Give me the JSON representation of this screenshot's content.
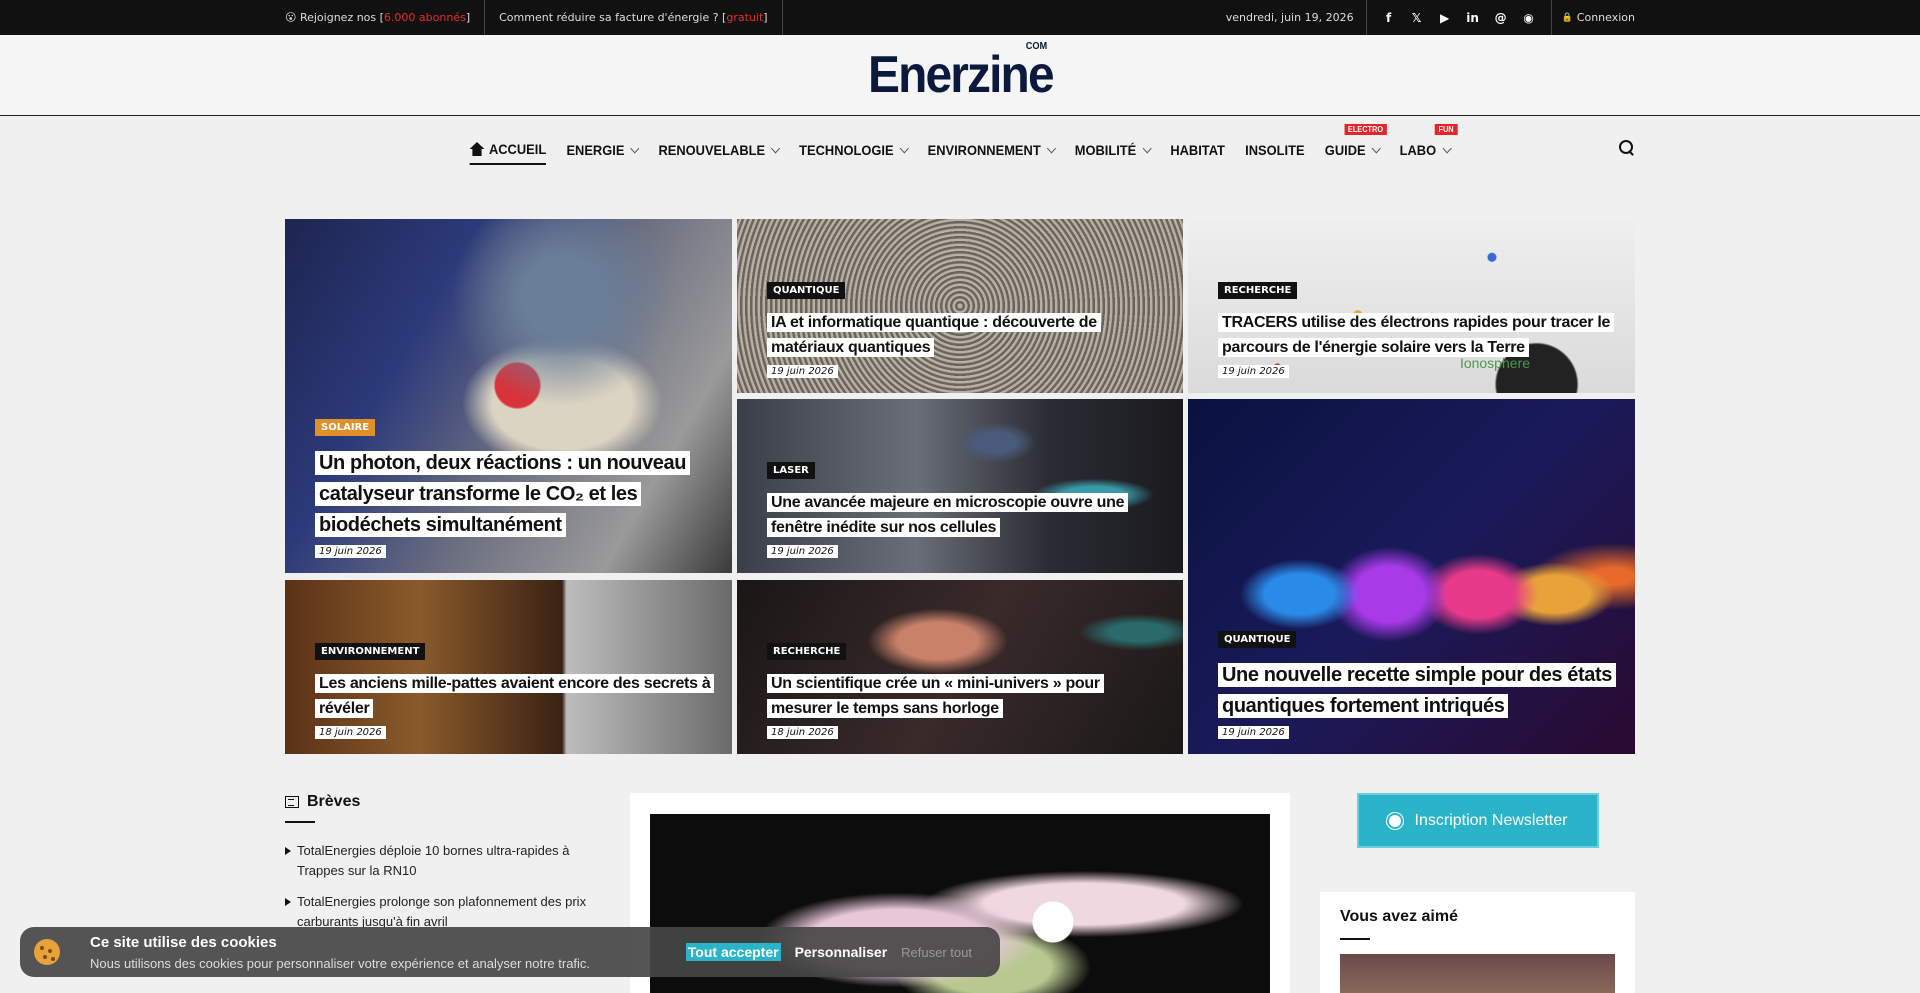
{
  "topbar": {
    "join_prefix": "😮 Rejoignez nos [",
    "join_count": "6.000 abonnés",
    "join_suffix": "]",
    "promo_text": "Comment réduire sa facture d'énergie ? [",
    "promo_free": "gratuit",
    "promo_suffix": "]",
    "date": "vendredi, juin 19, 2026",
    "social": [
      {
        "name": "facebook-icon",
        "glyph": "f"
      },
      {
        "name": "x-icon",
        "glyph": "𝕏"
      },
      {
        "name": "youtube-icon",
        "glyph": "▶"
      },
      {
        "name": "linkedin-icon",
        "glyph": "in"
      },
      {
        "name": "threads-icon",
        "glyph": "@"
      },
      {
        "name": "rss-icon",
        "glyph": "◉"
      }
    ],
    "login_icon": "🔒",
    "login_label": "Connexion"
  },
  "logo": {
    "main": "Enerzine",
    "suffix": "COM"
  },
  "nav": {
    "items": [
      {
        "label": "ACCUEIL",
        "active": true
      },
      {
        "label": "ENERGIE",
        "dropdown": true
      },
      {
        "label": "RENOUVELABLE",
        "dropdown": true
      },
      {
        "label": "TECHNOLOGIE",
        "dropdown": true
      },
      {
        "label": "ENVIRONNEMENT",
        "dropdown": true
      },
      {
        "label": "MOBILITÉ",
        "dropdown": true
      },
      {
        "label": "HABITAT"
      },
      {
        "label": "INSOLITE"
      },
      {
        "label": "GUIDE",
        "dropdown": true,
        "badge": "ELECTRO"
      },
      {
        "label": "LABO",
        "dropdown": true,
        "badge": "FUN"
      }
    ]
  },
  "articles": [
    {
      "category": "SOLAIRE",
      "title": "Un photon, deux réactions : un nouveau catalyseur transforme le CO₂ et les biodéchets simultanément",
      "date": "19 juin 2026"
    },
    {
      "category": "QUANTIQUE",
      "title": "IA et informatique quantique : découverte de matériaux quantiques",
      "date": "19 juin 2026"
    },
    {
      "category": "RECHERCHE",
      "title": "TRACERS utilise des électrons rapides pour tracer le parcours de l'énergie solaire vers la Terre",
      "date": "19 juin 2026"
    },
    {
      "category": "LASER",
      "title": "Une avancée majeure en microscopie ouvre une fenêtre inédite sur nos cellules",
      "date": "19 juin 2026"
    },
    {
      "category": "QUANTIQUE",
      "title": "Une nouvelle recette simple pour des états quantiques fortement intriqués",
      "date": "19 juin 2026"
    },
    {
      "category": "ENVIRONNEMENT",
      "title": "Les anciens mille-pattes avaient encore des secrets à révéler",
      "date": "18 juin 2026"
    },
    {
      "category": "RECHERCHE",
      "title": "Un scientifique crée un « mini-univers » pour mesurer le temps sans horloge",
      "date": "18 juin 2026"
    }
  ],
  "image_overlay_text": "Ionosphere",
  "breves": {
    "title": "Brèves",
    "items": [
      "TotalEnergies déploie 10 bornes ultra-rapides à Trappes sur la RN10",
      "TotalEnergies prolonge son plafonnement des prix carburants jusqu'à fin avril"
    ]
  },
  "sidebar": {
    "newsletter_label": "Inscription Newsletter",
    "liked_title": "Vous avez aimé"
  },
  "cookie": {
    "title": "Ce site utilise des cookies",
    "description": "Nous utilisons des cookies pour personnaliser votre expérience et analyser notre trafic.",
    "accept": "Tout accepter",
    "customize": "Personnaliser",
    "refuse": "Refuser tout"
  }
}
